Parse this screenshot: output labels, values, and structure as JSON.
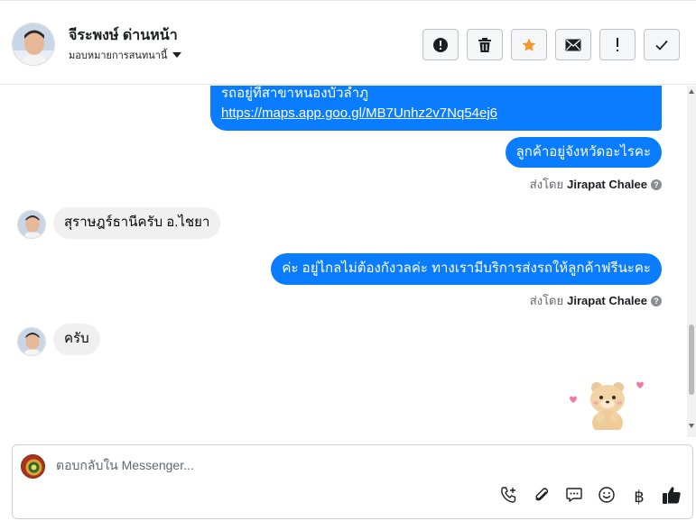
{
  "header": {
    "contact_name": "จีระพงษ์ ด่านหน้า",
    "assignment": "มอบหมายการสนทนานี้",
    "toolbar": [
      {
        "name": "mark-spam-button",
        "icon": "alert-circle-icon"
      },
      {
        "name": "delete-button",
        "icon": "trash-icon"
      },
      {
        "name": "star-button",
        "icon": "star-icon"
      },
      {
        "name": "mark-unread-button",
        "icon": "envelope-icon"
      },
      {
        "name": "flag-button",
        "icon": "exclamation-icon"
      },
      {
        "name": "mark-done-button",
        "icon": "checkmark-icon"
      }
    ]
  },
  "messages": [
    {
      "direction": "out",
      "text": "รถอยู่ที่สาขาหนองบัวลำภู",
      "link": "https://maps.app.goo.gl/MB7Unhz2v7Nq54ej6"
    },
    {
      "direction": "out",
      "text": "ลูกค้าอยู่จังหวัดอะไรคะ"
    },
    {
      "direction": "in",
      "text": "สุราษฎร์ธานีครับ อ.ไชยา"
    },
    {
      "direction": "out",
      "text": "ค่ะ อยู่ไกลไม่ต้องกังวลค่ะ ทางเรามีบริการส่งรถให้ลูกค้าฟรีนะคะ"
    },
    {
      "direction": "in",
      "text": "ครับ"
    },
    {
      "direction": "in",
      "sticker": "bear-sticker"
    }
  ],
  "sent_by": {
    "prefix": "ส่งโดย",
    "name": "Jirapat Chalee",
    "help": "?"
  },
  "composer": {
    "placeholder": "ตอบกลับใน Messenger...",
    "tools": [
      "phone-add-icon",
      "paperclip-icon",
      "saved-reply-icon",
      "emoji-icon",
      "baht-icon",
      "thumbs-up-icon"
    ],
    "baht_symbol": "฿"
  },
  "colors": {
    "outgoing_bubble": "#0a7cff",
    "incoming_bubble": "#f0f0f0",
    "star_accent": "#f5952b"
  }
}
